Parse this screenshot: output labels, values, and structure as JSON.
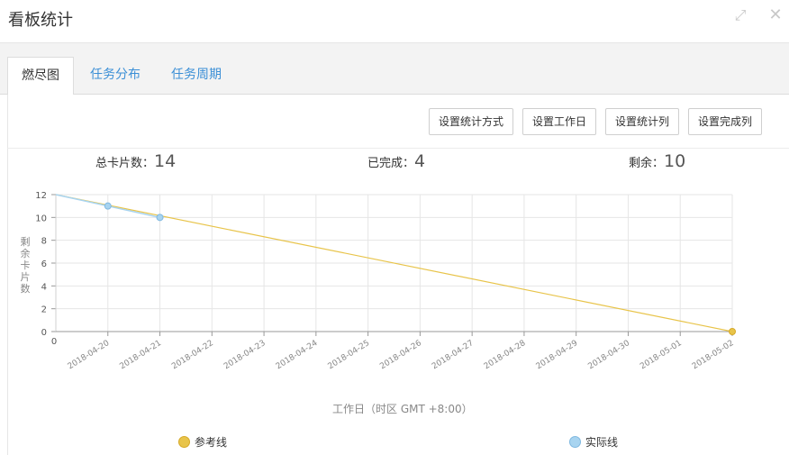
{
  "window": {
    "title": "看板统计",
    "expand_glyph": "⤢",
    "close_glyph": "✕"
  },
  "tabs": [
    {
      "label": "燃尽图",
      "active": true
    },
    {
      "label": "任务分布",
      "active": false
    },
    {
      "label": "任务周期",
      "active": false
    }
  ],
  "toolbar": {
    "buttons": [
      "设置统计方式",
      "设置工作日",
      "设置统计列",
      "设置完成列"
    ]
  },
  "stats": [
    {
      "label": "总卡片数：",
      "value": "14"
    },
    {
      "label": "已完成：",
      "value": "4"
    },
    {
      "label": "剩余：",
      "value": "10"
    }
  ],
  "chart_data": {
    "type": "line",
    "x": [
      "2018-04-20",
      "2018-04-21",
      "2018-04-22",
      "2018-04-23",
      "2018-04-24",
      "2018-04-25",
      "2018-04-26",
      "2018-04-27",
      "2018-04-28",
      "2018-04-29",
      "2018-04-30",
      "2018-05-01",
      "2018-05-02"
    ],
    "x_origin_label": "0",
    "ylabel": "剩余卡片数",
    "xlabel": "工作日（时区 GMT +8:00）",
    "ylim": [
      0,
      12
    ],
    "yticks": [
      0,
      2,
      4,
      6,
      8,
      10,
      12
    ],
    "grid": true,
    "legend_placement": "bottom",
    "series": [
      {
        "name": "参考线",
        "color": "#e8c44a",
        "points": [
          [
            "start",
            12
          ],
          [
            "2018-05-02",
            0
          ]
        ]
      },
      {
        "name": "实际线",
        "color": "#a8d4f0",
        "points": [
          [
            "start",
            12
          ],
          [
            "2018-04-20",
            11
          ],
          [
            "2018-04-21",
            10
          ]
        ]
      }
    ]
  }
}
